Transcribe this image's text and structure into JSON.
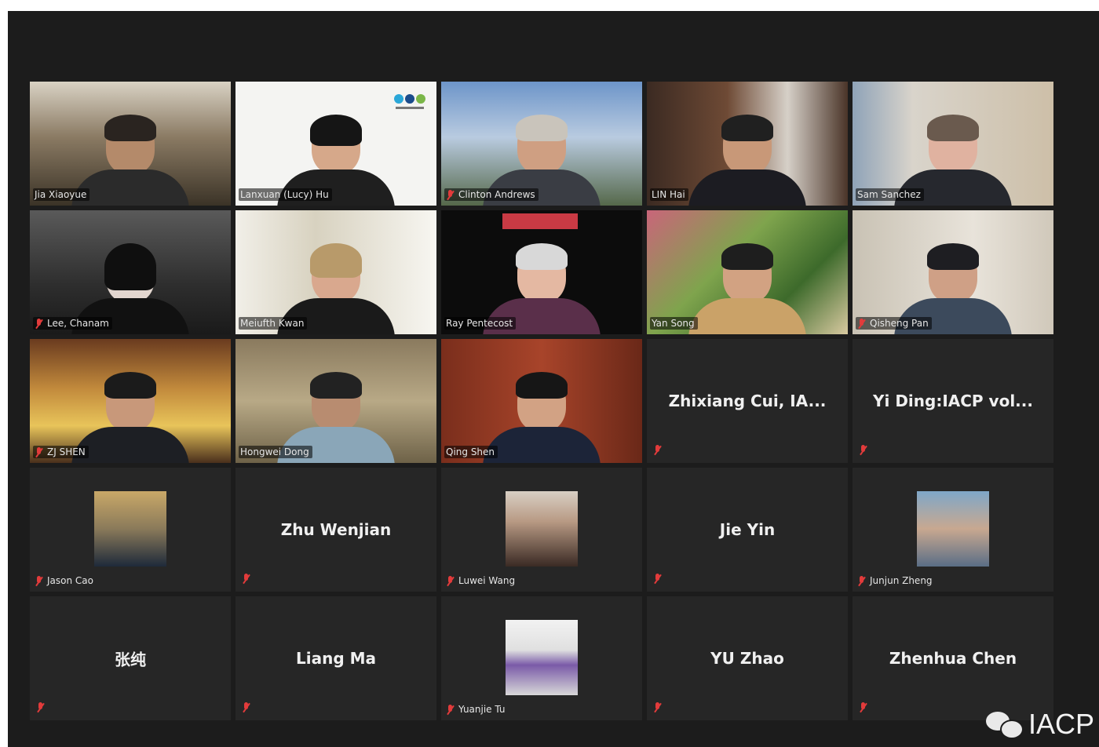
{
  "meeting": {
    "tiles": [
      {
        "name": "Jia Xiaoyue",
        "type": "video",
        "muted": false
      },
      {
        "name": "Lanxuan (Lucy) Hu",
        "type": "video",
        "muted": false,
        "speaking": true
      },
      {
        "name": "Clinton Andrews",
        "type": "video",
        "muted": true
      },
      {
        "name": "LIN Hai",
        "type": "video",
        "muted": false
      },
      {
        "name": "Sam Sanchez",
        "type": "video",
        "muted": false
      },
      {
        "name": "Lee, Chanam",
        "type": "video",
        "muted": true
      },
      {
        "name": "Meiufth Kwan",
        "type": "video",
        "muted": false
      },
      {
        "name": "Ray Pentecost",
        "type": "video",
        "muted": false
      },
      {
        "name": "Yan Song",
        "type": "video",
        "muted": false
      },
      {
        "name": "Qisheng Pan",
        "type": "video",
        "muted": true
      },
      {
        "name": "ZJ SHEN",
        "type": "video",
        "muted": true
      },
      {
        "name": "Hongwei Dong",
        "type": "video",
        "muted": false
      },
      {
        "name": "Qing Shen",
        "type": "video",
        "muted": false
      },
      {
        "name": "Zhixiang Cui, IA...",
        "type": "name-only",
        "muted": true
      },
      {
        "name": "Yi Ding:IACP vol...",
        "type": "name-only",
        "muted": true
      },
      {
        "name": "Jason Cao",
        "type": "avatar",
        "muted": true
      },
      {
        "name": "Zhu Wenjian",
        "type": "name-only",
        "muted": true
      },
      {
        "name": "Luwei Wang",
        "type": "avatar",
        "muted": true
      },
      {
        "name": "Jie Yin",
        "type": "name-only",
        "muted": true
      },
      {
        "name": "Junjun Zheng",
        "type": "avatar",
        "muted": true
      },
      {
        "name": "张纯",
        "type": "name-only",
        "muted": true
      },
      {
        "name": "Liang Ma",
        "type": "name-only",
        "muted": true
      },
      {
        "name": "Yuanjie Tu",
        "type": "avatar",
        "muted": true
      },
      {
        "name": "YU Zhao",
        "type": "name-only",
        "muted": true
      },
      {
        "name": "Zhenhua Chen",
        "type": "name-only",
        "muted": true
      }
    ]
  },
  "watermark": {
    "icon": "wechat-icon",
    "text": "IACP"
  },
  "colors": {
    "background": "#1c1c1c",
    "tile": "#262626",
    "active_speaker": "#c8e04a",
    "mute": "#e23b3b"
  }
}
